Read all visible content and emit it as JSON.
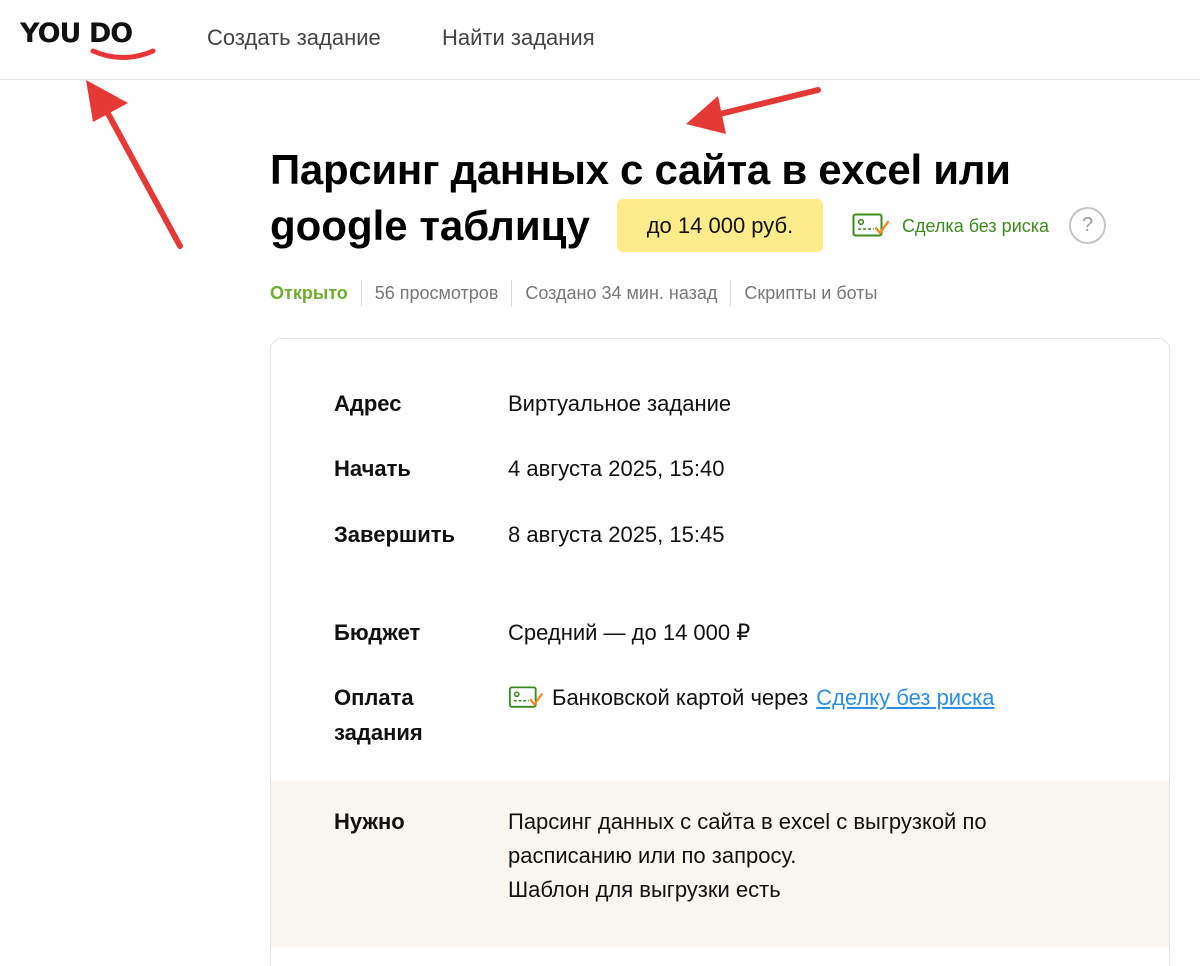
{
  "header": {
    "logo": "YOU DO",
    "nav": [
      "Создать задание",
      "Найти задания"
    ]
  },
  "task": {
    "title_line1": "Парсинг данных с сайта в excel или",
    "title_line2": "google таблицу",
    "price": "до 14 000 руб.",
    "safe_deal": "Сделка без риска",
    "help": "?",
    "meta": {
      "status": "Открыто",
      "views": "56 просмотров",
      "created": "Создано 34 мин. назад",
      "category": "Скрипты и боты"
    }
  },
  "details": {
    "address_label": "Адрес",
    "address_value": "Виртуальное задание",
    "start_label": "Начать",
    "start_value": "4 августа 2025, 15:40",
    "end_label": "Завершить",
    "end_value": "8 августа 2025, 15:45",
    "budget_label": "Бюджет",
    "budget_value": "Средний — до 14 000 ₽",
    "payment_label_line1": "Оплата",
    "payment_label_line2": "задания",
    "payment_text": "Банковской картой через",
    "payment_link": "Сделку без риска",
    "need_label": "Нужно",
    "need_line1": "Парсинг данных с сайта в excel с выгрузкой по",
    "need_line2": "расписанию или по запросу.",
    "need_line3": "Шаблон для выгрузки есть"
  },
  "colors": {
    "status_green": "#6fae2f",
    "safe_deal_green": "#3d8a1f",
    "price_badge_yellow": "#fdeb8c",
    "link_blue": "#2f8ee0",
    "arrow_red": "#e53935",
    "logo_red": "#e8363a"
  },
  "icons": [
    "card-check-icon",
    "help-icon",
    "logo-smile-icon",
    "annotation-arrow-icon"
  ]
}
